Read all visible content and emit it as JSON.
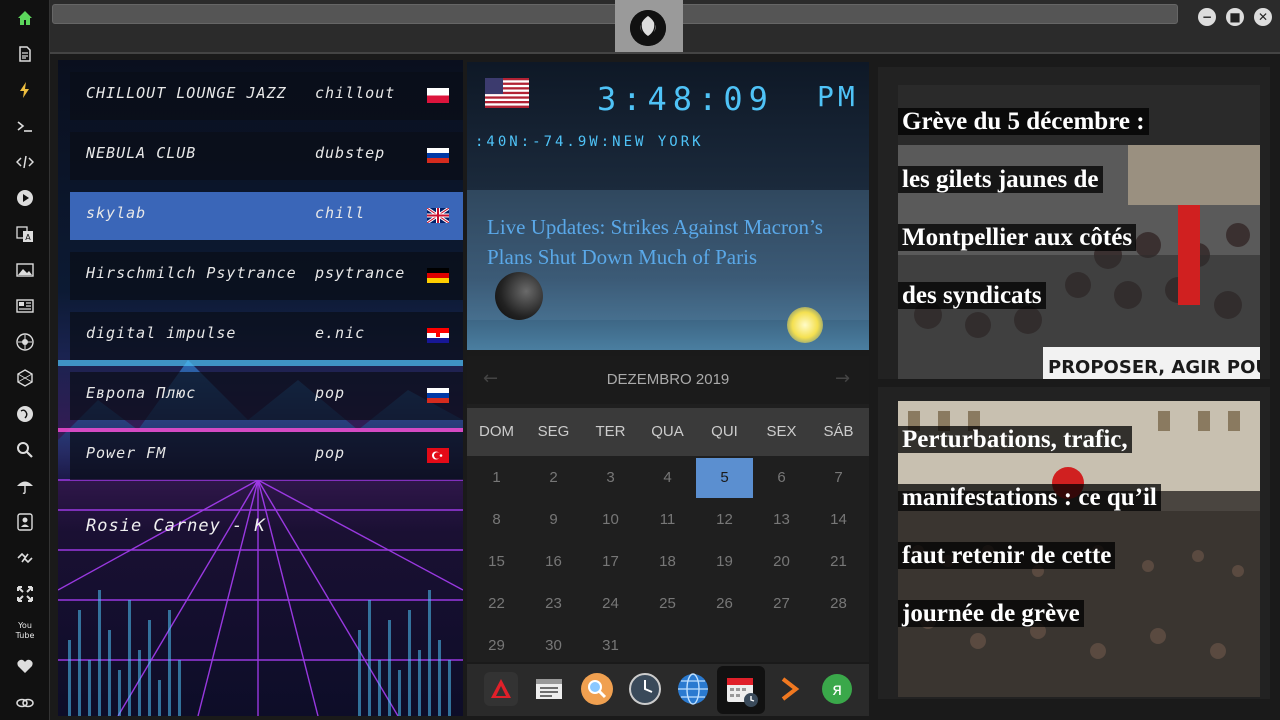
{
  "sidebar": {
    "icons": [
      "home-icon",
      "file-icon",
      "bolt-icon",
      "terminal-icon",
      "code-icon",
      "play-icon",
      "translate-icon",
      "image-icon",
      "newspaper-icon",
      "rebel-icon",
      "hexagon-icon",
      "globe-icon",
      "search-icon",
      "umbrella-icon",
      "contact-icon",
      "link-icon",
      "expand-icon",
      "youtube-icon",
      "heart-icon",
      "cloud-link-icon"
    ],
    "youtube_label": "You Tube"
  },
  "window": {
    "minimize": "−",
    "maximize": "■",
    "close": "✕"
  },
  "radio": {
    "stations": [
      {
        "name": "CHILLOUT LOUNGE JAZZ",
        "genre": "chillout",
        "flag": "pl"
      },
      {
        "name": "NEBULA CLUB",
        "genre": "dubstep",
        "flag": "ru"
      },
      {
        "name": "skylab",
        "genre": "chill",
        "flag": "gb",
        "active": true
      },
      {
        "name": "Hirschmilch Psytrance",
        "genre": "psytrance",
        "flag": "de"
      },
      {
        "name": "digital impulse",
        "genre": "e.nic",
        "flag": "hr"
      },
      {
        "name": "Европа Плюс",
        "genre": "pop",
        "flag": "ru"
      },
      {
        "name": "Power FM",
        "genre": "pop",
        "flag": "tr"
      }
    ],
    "now_playing": "Rosie Carney - K"
  },
  "clock": {
    "time": "3:48:09",
    "ampm": "PM",
    "location": ":40N:-74.9W:NEW YORK",
    "headline": "Live Updates: Strikes Against Macron’s Plans Shut Down Much of Paris"
  },
  "calendar": {
    "title": "DEZEMBRO 2019",
    "prev": "←",
    "next": "→",
    "weekdays": [
      "DOM",
      "SEG",
      "TER",
      "QUA",
      "QUI",
      "SEX",
      "SÁB"
    ],
    "days": [
      "1",
      "2",
      "3",
      "4",
      "5",
      "6",
      "7",
      "8",
      "9",
      "10",
      "11",
      "12",
      "13",
      "14",
      "15",
      "16",
      "17",
      "18",
      "19",
      "20",
      "21",
      "22",
      "23",
      "24",
      "25",
      "26",
      "27",
      "28",
      "29",
      "30",
      "31"
    ],
    "today": 5
  },
  "dock": {
    "apps": [
      "app-launcher-icon",
      "calendar-list-icon",
      "search-app-icon",
      "clock-app-icon",
      "globe-app-icon",
      "calendar-app-icon",
      "play-arrow-icon",
      "yandex-icon"
    ]
  },
  "news": [
    {
      "lines": [
        "Grève du 5 décembre :",
        "les gilets jaunes de",
        "Montpellier aux côtés",
        "des syndicats"
      ],
      "banner": "PROPOSER, AGIR POUR LE P"
    },
    {
      "lines": [
        "Perturbations, trafic,",
        "manifestations : ce qu’il",
        "faut retenir de cette",
        "journée de grève"
      ]
    }
  ],
  "colors": {
    "accent_blue": "#4fc3f7",
    "active_station": "#3a66b8",
    "today_highlight": "#5b8fd0",
    "headline_blue": "#5aa8e8"
  }
}
